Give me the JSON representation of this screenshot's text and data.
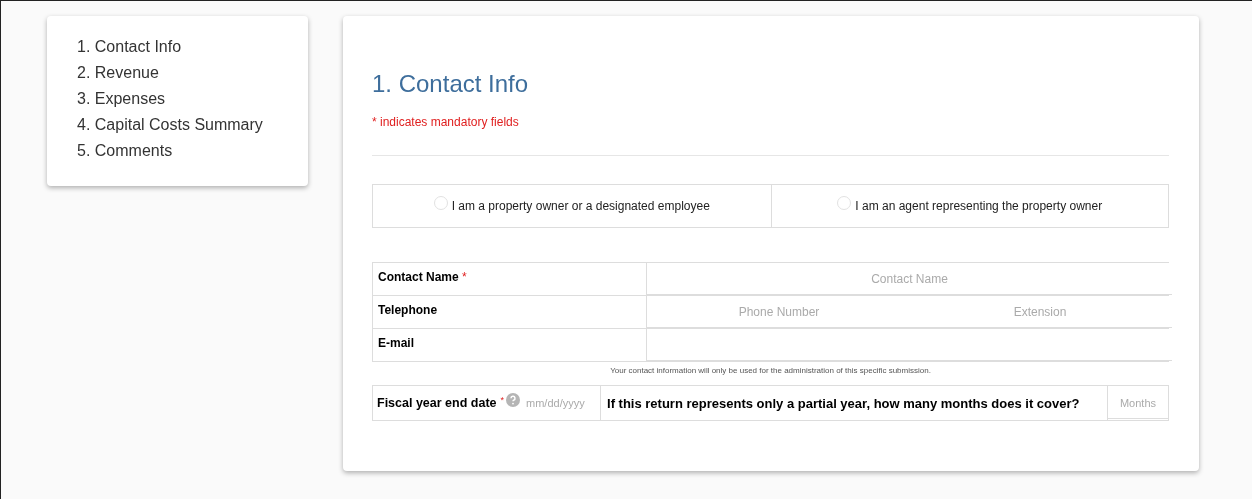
{
  "sidebar": {
    "items": [
      {
        "label": "1. Contact Info"
      },
      {
        "label": "2. Revenue"
      },
      {
        "label": "3. Expenses"
      },
      {
        "label": "4. Capital Costs Summary"
      },
      {
        "label": "5. Comments"
      }
    ]
  },
  "form": {
    "title": "1. Contact Info",
    "mandatory_note": "* indicates mandatory fields",
    "respondent_options": [
      {
        "label": "I am a property owner or a designated employee",
        "selected": false
      },
      {
        "label": "I am an agent representing the property owner",
        "selected": false
      }
    ],
    "contact_rows": [
      {
        "label": "Contact Name",
        "required_mark": "*",
        "fields": [
          {
            "placeholder": "Contact Name"
          }
        ]
      },
      {
        "label": "Telephone",
        "fields": [
          {
            "placeholder": "Phone Number"
          },
          {
            "placeholder": "Extension"
          }
        ]
      },
      {
        "label": "E-mail"
      }
    ],
    "privacy_note": "Your contact information will only be used for the administration of this specific submission.",
    "fiscal": {
      "label": "Fiscal year end date",
      "required_mark": "*",
      "placeholder": "mm/dd/yyyy",
      "question": "If this return represents only a partial year, how many months does it cover?",
      "months_placeholder": "Months"
    }
  }
}
